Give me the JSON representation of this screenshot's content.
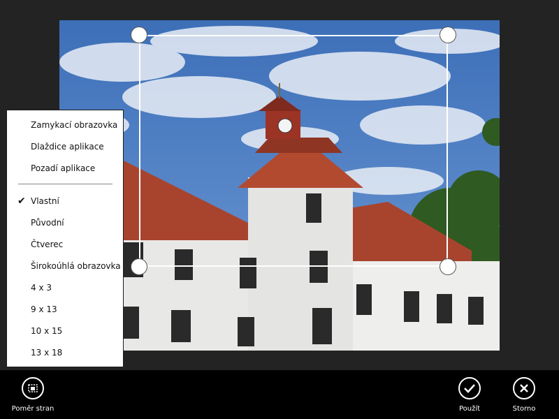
{
  "photo": {
    "subject": "castle-tower-photo"
  },
  "aspect_menu": {
    "group_targets": [
      {
        "label": "Zamykací obrazovka"
      },
      {
        "label": "Dlaždice aplikace"
      },
      {
        "label": "Pozadí aplikace"
      }
    ],
    "group_ratios": [
      {
        "label": "Vlastní",
        "checked": true
      },
      {
        "label": "Původní",
        "checked": false
      },
      {
        "label": "Čtverec",
        "checked": false
      },
      {
        "label": "Širokoúhlá obrazovka",
        "checked": false
      },
      {
        "label": "4 x 3",
        "checked": false
      },
      {
        "label": "9 x 13",
        "checked": false
      },
      {
        "label": "10 x 15",
        "checked": false
      },
      {
        "label": "13 x 18",
        "checked": false
      }
    ],
    "check_glyph": "✔"
  },
  "appbar": {
    "aspect_label": "Poměr stran",
    "apply_label": "Použít",
    "cancel_label": "Storno"
  },
  "colors": {
    "background": "#232323",
    "appbar": "#000000",
    "menu_bg": "#ffffff",
    "crop_frame": "#ffffff"
  }
}
